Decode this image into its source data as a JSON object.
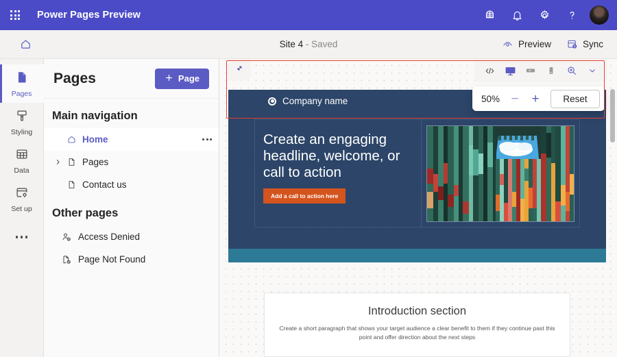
{
  "topbar": {
    "waffle_icon": "app-launcher-waffle-icon",
    "title": "Power Pages Preview",
    "icons": [
      {
        "name": "environment-globe-icon",
        "label": "Environment"
      },
      {
        "name": "notification-bell-icon",
        "label": "Notifications"
      },
      {
        "name": "settings-gear-icon",
        "label": "Settings"
      },
      {
        "name": "help-question-icon",
        "label": "Help"
      }
    ],
    "avatar": "user-avatar"
  },
  "cmdbar": {
    "home_icon": "home-icon",
    "site_name": "Site 4",
    "save_state": " - Saved",
    "preview_label": "Preview",
    "preview_icon": "eye-preview-icon",
    "sync_label": "Sync",
    "sync_icon": "database-sync-icon"
  },
  "rail": {
    "items": [
      {
        "label": "Pages",
        "icon": "page-icon",
        "selected": true
      },
      {
        "label": "Styling",
        "icon": "paint-brush-icon",
        "selected": false
      },
      {
        "label": "Data",
        "icon": "table-grid-icon",
        "selected": false
      },
      {
        "label": "Set up",
        "icon": "setup-gear-window-icon",
        "selected": false
      }
    ],
    "more_label": "More",
    "more_icon": "ellipsis-icon"
  },
  "panel": {
    "title": "Pages",
    "add_button": {
      "label": "Page",
      "icon": "plus-icon"
    },
    "sections": [
      {
        "title": "Main navigation",
        "items": [
          {
            "label": "Home",
            "icon": "home-icon",
            "active": true,
            "expandable": false,
            "menu": true
          },
          {
            "label": "Pages",
            "icon": "page-icon",
            "active": false,
            "expandable": true,
            "menu": false
          },
          {
            "label": "Contact us",
            "icon": "page-icon",
            "active": false,
            "expandable": false,
            "menu": false
          }
        ]
      },
      {
        "title": "Other pages",
        "items": [
          {
            "label": "Access Denied",
            "icon": "person-blocked-icon",
            "active": false,
            "expandable": false,
            "menu": false
          },
          {
            "label": "Page Not Found",
            "icon": "page-blocked-icon",
            "active": false,
            "expandable": false,
            "menu": false
          }
        ]
      }
    ]
  },
  "canvas": {
    "expand_icon": "expand-diagonal-icon",
    "toolbar": [
      {
        "name": "code-view-icon",
        "glyph": "</>",
        "active": false
      },
      {
        "name": "desktop-view-icon",
        "glyph": "desktop",
        "active": true
      },
      {
        "name": "tablet-view-icon",
        "glyph": "tablet",
        "active": false
      },
      {
        "name": "mobile-view-icon",
        "glyph": "mobile",
        "active": false
      },
      {
        "name": "zoom-in-icon",
        "glyph": "zoom",
        "active": true
      },
      {
        "name": "chevron-down-icon",
        "glyph": "chevron",
        "active": false
      }
    ],
    "zoom_popup": {
      "value": "50%",
      "minus_label": "−",
      "plus_label": "+",
      "reset_label": "Reset"
    },
    "highlight_color": "#e8403a"
  },
  "site_preview": {
    "company_name": "Company name",
    "hero_headline": "Create an engaging headline, welcome, or call to action",
    "cta_label": "Add a call to action here",
    "hero_image_alt": "colorful shipping containers viewed from below against blue sky",
    "intro_heading": "Introduction section",
    "intro_paragraph": "Create a short paragraph that shows your target audience a clear benefit to them if they continue past this point and offer direction about the next steps"
  },
  "colors": {
    "brand_purple": "#4b4bc8",
    "accent_purple": "#5b5bc4",
    "site_navy": "#2c4568",
    "site_teal": "#2c7a96",
    "cta_orange": "#d4541e"
  }
}
